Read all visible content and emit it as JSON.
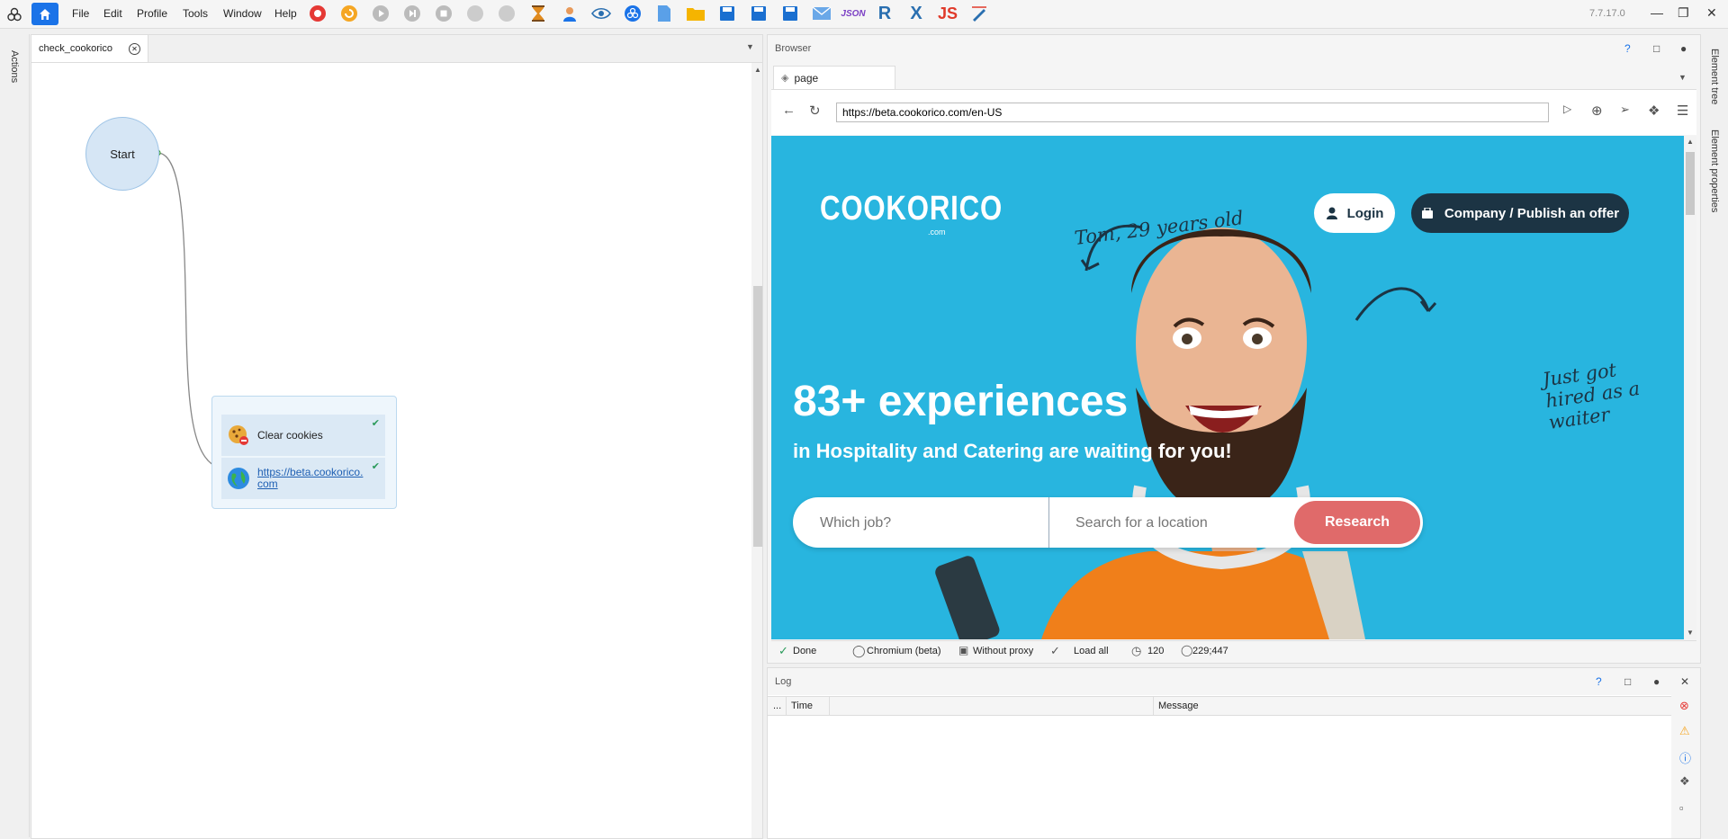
{
  "menu": {
    "items": [
      "File",
      "Edit",
      "Profile",
      "Tools",
      "Window",
      "Help"
    ],
    "version": "7.7.17.0"
  },
  "left_rail": {
    "label": "Actions"
  },
  "right_rail": {
    "labels": [
      "Element tree",
      "Element properties"
    ]
  },
  "editor": {
    "tab_label": "check_cookorico",
    "start_label": "Start",
    "actions": [
      {
        "label": "Clear cookies"
      },
      {
        "label": "https://beta.cookorico.com",
        "line1": "https://beta.cookorico.",
        "line2": "com"
      }
    ]
  },
  "browser": {
    "panel_title": "Browser",
    "tab_label": "page",
    "url": "https://beta.cookorico.com/en-US",
    "website": {
      "logo": "COOKORICO",
      "logo_sub": ".com",
      "login_label": "Login",
      "company_label": "Company / Publish an offer",
      "tom_caption": "Tom, 29 years old",
      "hired_caption": "Just got hired as a waiter",
      "hired_lines": [
        "Just got",
        "hired as a",
        "waiter"
      ],
      "headline": "83+ experiences",
      "subheadline": "in Hospitality and Catering are waiting for you!",
      "job_placeholder": "Which job?",
      "location_placeholder": "Search for a location",
      "search_button": "Research"
    },
    "status": {
      "state": "Done",
      "engine": "Chromium (beta)",
      "proxy": "Without proxy",
      "load": "Load all",
      "timer": "120",
      "coords": "229;447"
    }
  },
  "log": {
    "title": "Log",
    "columns": [
      "...",
      "Time",
      "Message"
    ]
  },
  "colors": {
    "web_bg": "#28b5df",
    "dark_button": "#1c3444",
    "search_button": "#e06a6a",
    "shirt": "#f07f1a",
    "accent_blue": "#1a73e8"
  },
  "icons": [
    "home-icon",
    "record-icon",
    "refresh-icon",
    "play-icon",
    "step-icon",
    "stop-icon",
    "hourglass-icon",
    "user-icon",
    "eye-icon",
    "network-icon",
    "file-icon",
    "folder-icon",
    "save-icon",
    "mail-icon",
    "json-icon",
    "regex-icon",
    "xpath-icon",
    "js-icon",
    "pen-icon"
  ]
}
